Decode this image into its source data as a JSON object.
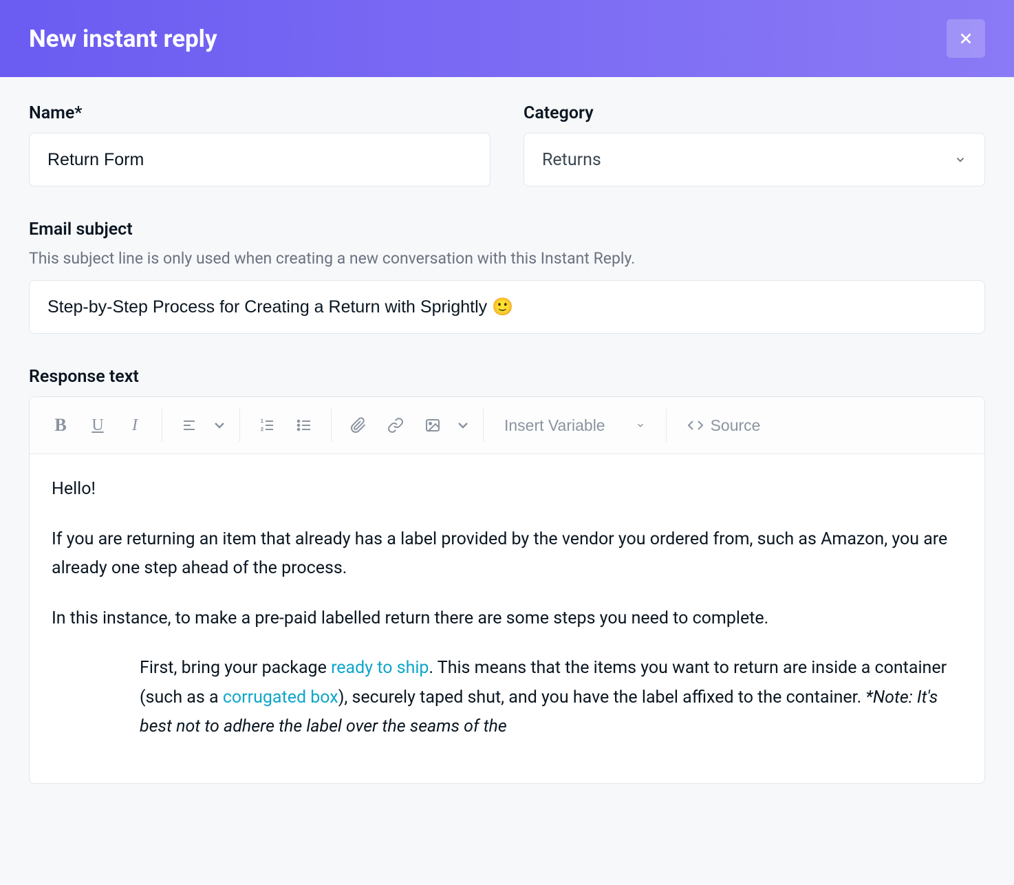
{
  "modal": {
    "title": "New instant reply"
  },
  "fields": {
    "name": {
      "label": "Name*",
      "value": "Return Form"
    },
    "category": {
      "label": "Category",
      "selected": "Returns"
    },
    "emailSubject": {
      "label": "Email subject",
      "helper": "This subject line is only used when creating a new conversation with this Instant Reply.",
      "value": "Step-by-Step Process for Creating a Return with Sprightly 🙂"
    },
    "responseText": {
      "label": "Response text"
    }
  },
  "toolbar": {
    "insertVariable": "Insert Variable",
    "source": "Source"
  },
  "response": {
    "p1": "Hello!",
    "p2": "If you are returning an item that already has a label provided by the vendor you ordered from, such as Amazon, you are already one step ahead of the process.",
    "p3": "In this instance, to make a pre-paid labelled return there are some steps you need to complete.",
    "indent": {
      "before_link1": "First, bring your package ",
      "link1": "ready to ship",
      "mid1": ". This means that the items you want to return are inside a container (such as a ",
      "link2": "corrugated box",
      "mid2": "), securely taped shut, and you have the label affixed to the container. ",
      "italic": "*Note: It's best not to adhere the label over the seams of the"
    }
  }
}
